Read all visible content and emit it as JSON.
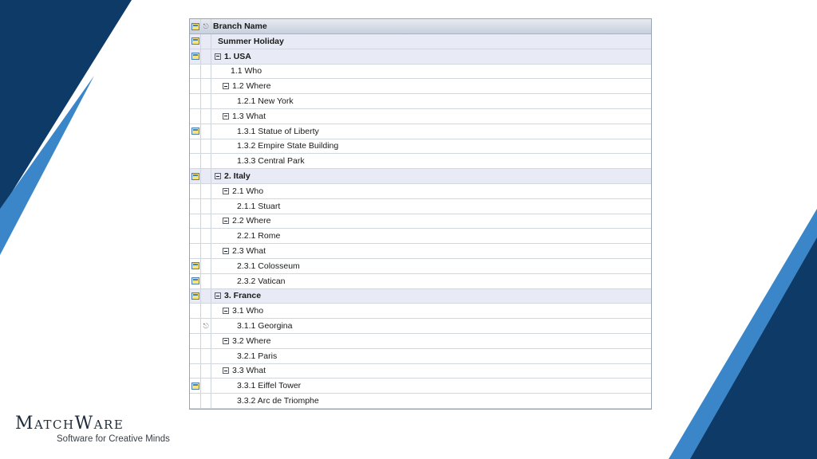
{
  "tree": {
    "header": {
      "label": "Branch Name"
    },
    "rows": [
      {
        "label": "Summer Holiday",
        "level": 0,
        "top": true,
        "note": true,
        "clip": false,
        "toggle": false
      },
      {
        "label": "1. USA",
        "level": 0,
        "top": true,
        "note": true,
        "clip": false,
        "toggle": true
      },
      {
        "label": "1.1 Who",
        "level": 2,
        "top": false,
        "note": false,
        "clip": false,
        "toggle": false
      },
      {
        "label": "1.2 Where",
        "level": 1,
        "top": false,
        "note": false,
        "clip": false,
        "toggle": true
      },
      {
        "label": "1.2.1 New York",
        "level": 3,
        "top": false,
        "note": false,
        "clip": false,
        "toggle": false
      },
      {
        "label": "1.3 What",
        "level": 1,
        "top": false,
        "note": false,
        "clip": false,
        "toggle": true
      },
      {
        "label": "1.3.1 Statue of Liberty",
        "level": 3,
        "top": false,
        "note": true,
        "clip": false,
        "toggle": false
      },
      {
        "label": "1.3.2 Empire State Building",
        "level": 3,
        "top": false,
        "note": false,
        "clip": false,
        "toggle": false
      },
      {
        "label": "1.3.3 Central Park",
        "level": 3,
        "top": false,
        "note": false,
        "clip": false,
        "toggle": false
      },
      {
        "label": "2. Italy",
        "level": 0,
        "top": true,
        "note": true,
        "clip": false,
        "toggle": true
      },
      {
        "label": "2.1 Who",
        "level": 1,
        "top": false,
        "note": false,
        "clip": false,
        "toggle": true
      },
      {
        "label": "2.1.1 Stuart",
        "level": 3,
        "top": false,
        "note": false,
        "clip": false,
        "toggle": false
      },
      {
        "label": "2.2 Where",
        "level": 1,
        "top": false,
        "note": false,
        "clip": false,
        "toggle": true
      },
      {
        "label": "2.2.1 Rome",
        "level": 3,
        "top": false,
        "note": false,
        "clip": false,
        "toggle": false
      },
      {
        "label": "2.3 What",
        "level": 1,
        "top": false,
        "note": false,
        "clip": false,
        "toggle": true
      },
      {
        "label": "2.3.1 Colosseum",
        "level": 3,
        "top": false,
        "note": true,
        "clip": false,
        "toggle": false
      },
      {
        "label": "2.3.2 Vatican",
        "level": 3,
        "top": false,
        "note": true,
        "clip": false,
        "toggle": false
      },
      {
        "label": "3. France",
        "level": 0,
        "top": true,
        "note": true,
        "clip": false,
        "toggle": true
      },
      {
        "label": "3.1 Who",
        "level": 1,
        "top": false,
        "note": false,
        "clip": false,
        "toggle": true
      },
      {
        "label": "3.1.1 Georgina",
        "level": 3,
        "top": false,
        "note": false,
        "clip": true,
        "toggle": false
      },
      {
        "label": "3.2 Where",
        "level": 1,
        "top": false,
        "note": false,
        "clip": false,
        "toggle": true
      },
      {
        "label": "3.2.1 Paris",
        "level": 3,
        "top": false,
        "note": false,
        "clip": false,
        "toggle": false
      },
      {
        "label": "3.3 What",
        "level": 1,
        "top": false,
        "note": false,
        "clip": false,
        "toggle": true
      },
      {
        "label": "3.3.1 Eiffel Tower",
        "level": 3,
        "top": false,
        "note": true,
        "clip": false,
        "toggle": false
      },
      {
        "label": "3.3.2 Arc de Triomphe",
        "level": 3,
        "top": false,
        "note": false,
        "clip": false,
        "toggle": false
      }
    ]
  },
  "brand": {
    "name": "MatchWare",
    "tagline": "Software for Creative Minds"
  },
  "icons": {
    "note": "note-icon",
    "attachment": "paperclip-icon",
    "toggle": "collapse-toggle-icon"
  },
  "colors": {
    "navy": "#0d3a66",
    "accent_blue": "#3b86c8",
    "top_row_bg": "#e8ebf5"
  }
}
